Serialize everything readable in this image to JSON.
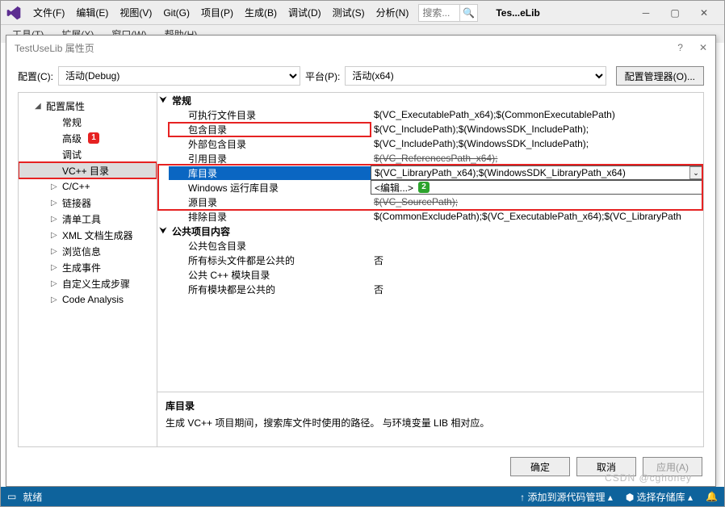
{
  "menus": {
    "file": "文件(F)",
    "edit": "编辑(E)",
    "view": "视图(V)",
    "git": "Git(G)",
    "project": "项目(P)",
    "build": "生成(B)",
    "debug": "调试(D)",
    "test": "测试(S)",
    "analyze": "分析(N)",
    "tools": "工具(T)",
    "ext": "扩展(X)",
    "window": "窗口(W)",
    "help": "帮助(H)"
  },
  "search_placeholder": "搜索...",
  "title_short": "Tes...eLib",
  "dialog_title": "TestUseLib 属性页",
  "cfg": {
    "label": "配置(C):",
    "value": "活动(Debug)",
    "platform_label": "平台(P):",
    "platform_value": "活动(x64)",
    "mgr_btn": "配置管理器(O)..."
  },
  "tree": {
    "root": "配置属性",
    "items": [
      "常规",
      "高级",
      "调试",
      "VC++ 目录",
      "C/C++",
      "链接器",
      "清单工具",
      "XML 文档生成器",
      "浏览信息",
      "生成事件",
      "自定义生成步骤",
      "Code Analysis"
    ]
  },
  "callouts": {
    "one": "1",
    "two": "2"
  },
  "grid": {
    "g1": "常规",
    "r1": {
      "k": "可执行文件目录",
      "v": "$(VC_ExecutablePath_x64);$(CommonExecutablePath)"
    },
    "r2": {
      "k": "包含目录",
      "v": "$(VC_IncludePath);$(WindowsSDK_IncludePath);"
    },
    "r3": {
      "k": "外部包含目录",
      "v": "$(VC_IncludePath);$(WindowsSDK_IncludePath);"
    },
    "r4": {
      "k": "引用目录",
      "v": "$(VC_ReferencesPath_x64);"
    },
    "r5": {
      "k": "库目录",
      "v": "$(VC_LibraryPath_x64);$(WindowsSDK_LibraryPath_x64)"
    },
    "r6": {
      "k": "Windows 运行库目录",
      "v": "<编辑...>"
    },
    "r7": {
      "k": "源目录",
      "v": "$(VC_SourcePath);"
    },
    "r8": {
      "k": "排除目录",
      "v": "$(CommonExcludePath);$(VC_ExecutablePath_x64);$(VC_LibraryPath"
    },
    "g2": "公共项目内容",
    "r9": {
      "k": "公共包含目录",
      "v": ""
    },
    "r10": {
      "k": "所有标头文件都是公共的",
      "v": "否"
    },
    "r11": {
      "k": "公共 C++ 模块目录",
      "v": ""
    },
    "r12": {
      "k": "所有模块都是公共的",
      "v": "否"
    }
  },
  "desc": {
    "title": "库目录",
    "text": "生成 VC++ 项目期间，搜索库文件时使用的路径。    与环境变量 LIB 相对应。"
  },
  "buttons": {
    "ok": "确定",
    "cancel": "取消",
    "apply": "应用(A)"
  },
  "status": {
    "ready": "就绪",
    "add_src": "添加到源代码管理",
    "select_repo": "选择存储库"
  },
  "watermark": "CSDN @cghoney"
}
